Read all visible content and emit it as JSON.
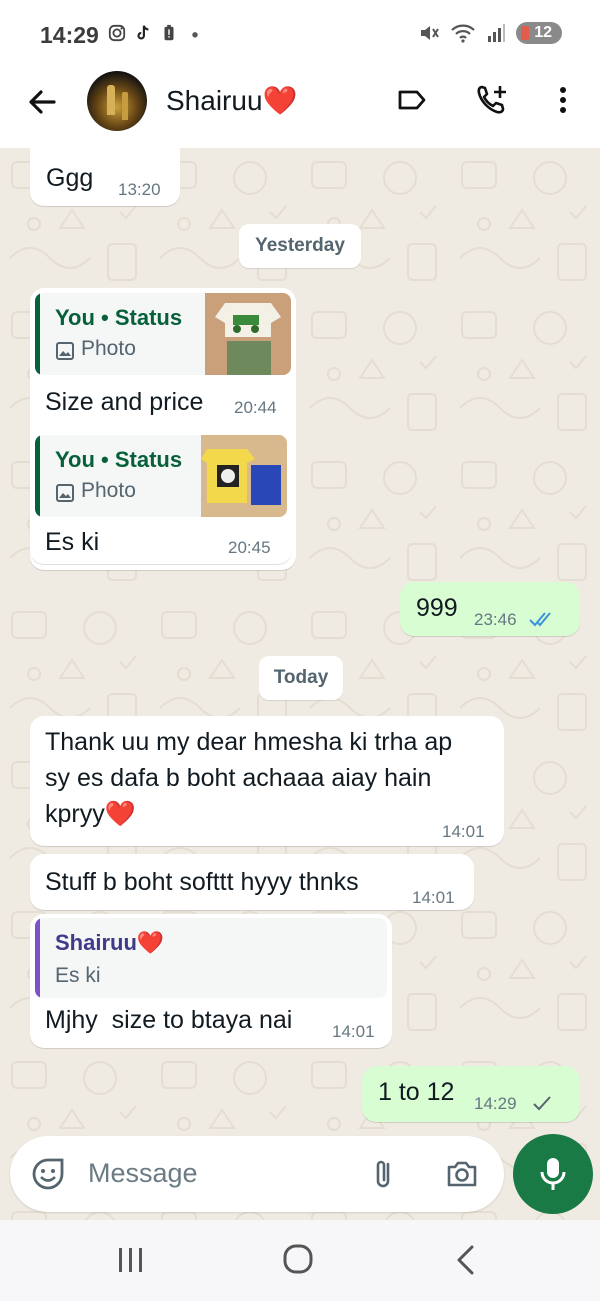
{
  "status_bar": {
    "time": "14:29",
    "battery": "12"
  },
  "header": {
    "contact_name": "Shairuu❤️"
  },
  "day_chips": {
    "yesterday": "Yesterday",
    "today": "Today"
  },
  "messages": [
    {
      "dir": "in",
      "text": "Ggg",
      "time": "13:20"
    },
    {
      "dir": "in",
      "quote_title": "You • Status",
      "quote_sub": "Photo",
      "text": "Size and price",
      "time": "20:44"
    },
    {
      "dir": "in",
      "quote_title": "You • Status",
      "quote_sub": "Photo",
      "text": "Es ki",
      "time": "20:45"
    },
    {
      "dir": "out",
      "text": "999",
      "time": "23:46",
      "status": "read"
    },
    {
      "dir": "in",
      "text": "Thank uu my dear hmesha ki trha ap\nsy es dafa b boht achaaa aiay hain\nkpryy❤️",
      "time": "14:01"
    },
    {
      "dir": "in",
      "text": "Stuff b boht softtt hyyy thnks",
      "time": "14:01"
    },
    {
      "dir": "in",
      "quote_title": "Shairuu❤️",
      "quote_sub": "Es ki",
      "text": "Mjhy  size to btaya nai",
      "time": "14:01"
    },
    {
      "dir": "out",
      "text": "1 to 12",
      "time": "14:29",
      "status": "sent"
    }
  ],
  "input": {
    "placeholder": "Message"
  },
  "colors": {
    "out_bubble": "#d9fdd3",
    "in_bubble": "#ffffff",
    "chat_bg": "#efeae2",
    "status_quote_bar": "#06603a",
    "reply_quote_bar": "#7d52c9",
    "reply_quote_name": "#3f3a8a",
    "read_tick": "#3a93d8",
    "mic_button": "#1a7a45"
  },
  "icons": {
    "back": "arrow-left-icon",
    "label": "label-tag-icon",
    "call": "add-call-icon",
    "menu": "more-vertical-icon",
    "emoji": "sticker-emoji-icon",
    "attach": "paperclip-icon",
    "camera": "camera-icon",
    "mic": "microphone-icon",
    "nav_recents": "recents-icon",
    "nav_home": "home-icon",
    "nav_back": "nav-back-icon"
  }
}
